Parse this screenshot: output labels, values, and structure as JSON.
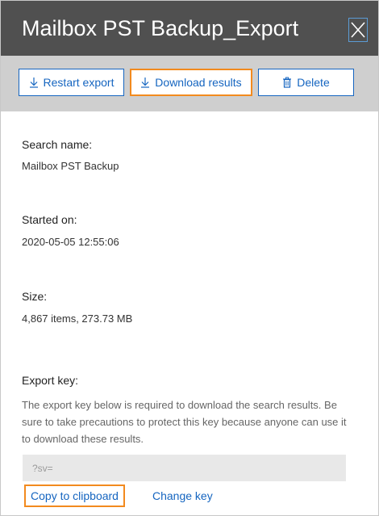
{
  "header": {
    "title": "Mailbox PST Backup_Export",
    "close_icon": "close-icon"
  },
  "toolbar": {
    "restart_label": "Restart export",
    "restart_icon": "download-arrow-icon",
    "download_label": "Download results",
    "download_icon": "download-arrow-icon",
    "delete_label": "Delete",
    "delete_icon": "trash-icon"
  },
  "details": {
    "search_name_label": "Search name:",
    "search_name_value": "Mailbox PST Backup",
    "started_label": "Started on:",
    "started_value": "2020-05-05 12:55:06",
    "size_label": "Size:",
    "size_value": "4,867 items, 273.73 MB"
  },
  "export_key": {
    "label": "Export key:",
    "description": "The export key below is required to download the search results. Be sure to take precautions to protect this key because anyone can use it to download these results.",
    "placeholder": "?sv=",
    "copy_label": "Copy to clipboard",
    "change_label": "Change key"
  },
  "colors": {
    "header_bg": "#505050",
    "toolbar_bg": "#cfcfcf",
    "accent": "#1565c0",
    "highlight": "#f28a1e"
  }
}
